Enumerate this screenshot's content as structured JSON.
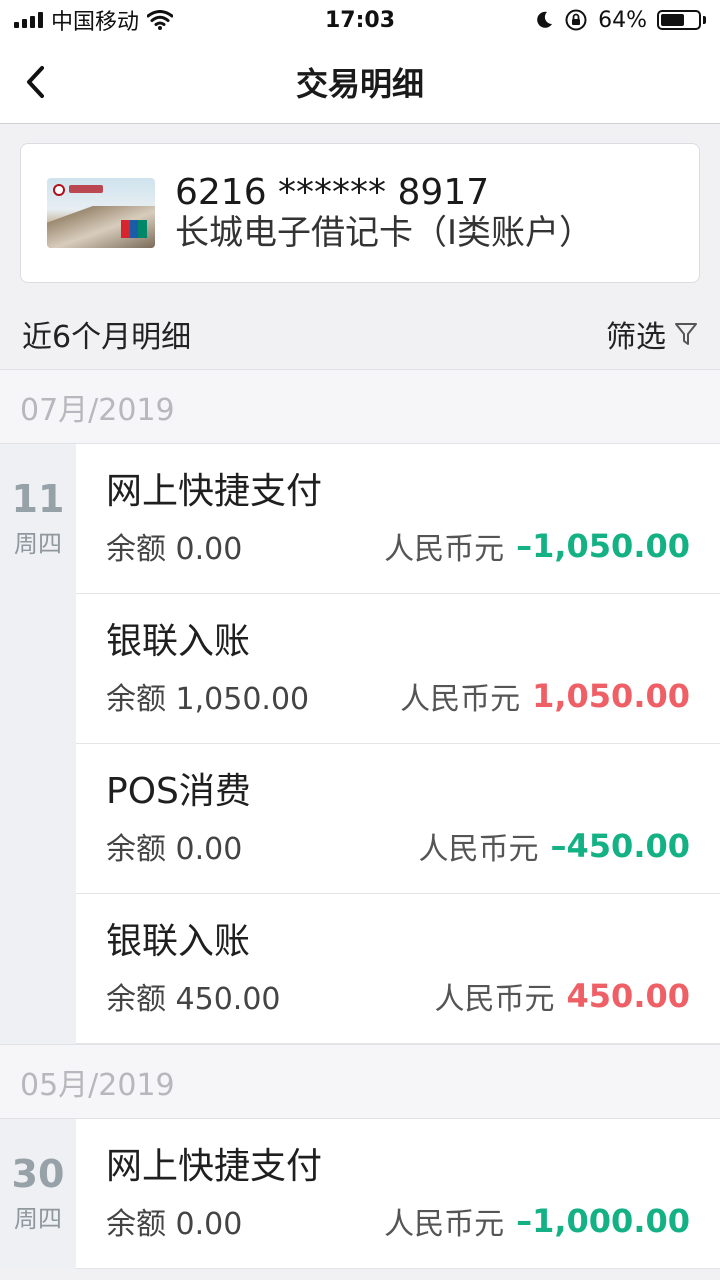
{
  "status_bar": {
    "carrier": "中国移动",
    "time": "17:03",
    "battery_text": "64%",
    "battery_level": 0.64
  },
  "nav": {
    "title": "交易明细"
  },
  "card": {
    "number": "6216 ****** 8917",
    "name": "长城电子借记卡（I类账户）"
  },
  "section": {
    "title": "近6个月明细",
    "filter_label": "筛选"
  },
  "months": [
    {
      "label": "07月/2019",
      "days": [
        {
          "day": "11",
          "weekday": "周四",
          "entries": [
            {
              "title": "网上快捷支付",
              "balance": "余额 0.00",
              "currency": "人民币元",
              "amount": "–1,050.00",
              "direction": "out"
            },
            {
              "title": "银联入账",
              "balance": "余额 1,050.00",
              "currency": "人民币元",
              "amount": "1,050.00",
              "direction": "in"
            },
            {
              "title": "POS消费",
              "balance": "余额 0.00",
              "currency": "人民币元",
              "amount": "–450.00",
              "direction": "out"
            },
            {
              "title": "银联入账",
              "balance": "余额 450.00",
              "currency": "人民币元",
              "amount": "450.00",
              "direction": "in"
            }
          ]
        }
      ]
    },
    {
      "label": "05月/2019",
      "days": [
        {
          "day": "30",
          "weekday": "周四",
          "entries": [
            {
              "title": "网上快捷支付",
              "balance": "余额 0.00",
              "currency": "人民币元",
              "amount": "–1,000.00",
              "direction": "out"
            }
          ]
        }
      ]
    }
  ],
  "colors": {
    "outgoing": "#14b184",
    "incoming": "#ee6066"
  }
}
